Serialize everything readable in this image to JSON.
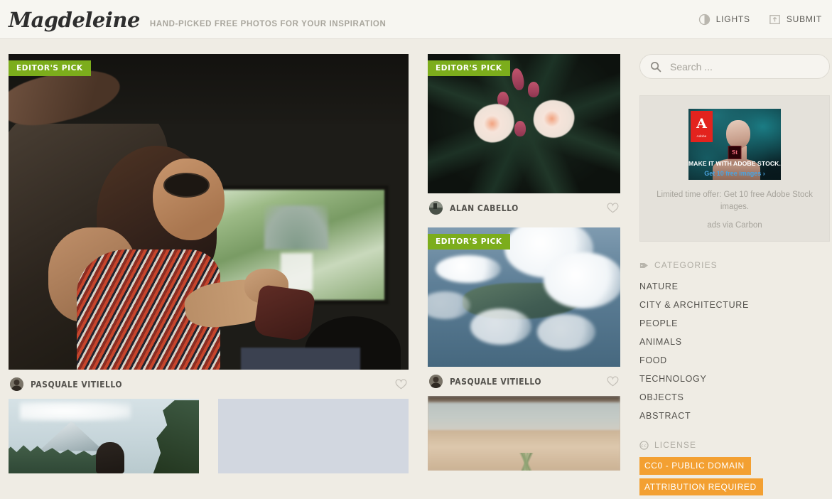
{
  "header": {
    "logo": "Magdeleine",
    "tagline": "HAND-PICKED FREE PHOTOS FOR YOUR INSPIRATION",
    "actions": [
      {
        "label": "LIGHTS",
        "icon": "contrast-icon"
      },
      {
        "label": "SUBMIT",
        "icon": "upload-icon"
      }
    ]
  },
  "badges": {
    "editors_pick": "EDITOR'S PICK"
  },
  "gallery": {
    "left_column": [
      {
        "photo_name": "woman-in-car-window",
        "editors_pick": true,
        "author": "PASQUALE VITIELLO",
        "fav_icon": "heart-outline-icon"
      },
      {
        "photo_name": "mountain-forest-person",
        "editors_pick": false,
        "author": "",
        "fav_icon": "heart-outline-icon"
      },
      {
        "photo_name": "loading-placeholder",
        "editors_pick": false,
        "author": "",
        "fav_icon": "heart-outline-icon"
      }
    ],
    "right_column": [
      {
        "photo_name": "pink-white-oleander-flowers",
        "editors_pick": true,
        "author": "ALAN CABELLO",
        "fav_icon": "heart-outline-icon"
      },
      {
        "photo_name": "clouds-over-coastline",
        "editors_pick": true,
        "author": "PASQUALE VITIELLO",
        "fav_icon": "heart-outline-icon"
      },
      {
        "photo_name": "desert-plant-closeup",
        "editors_pick": false,
        "author": "",
        "fav_icon": "heart-outline-icon"
      }
    ]
  },
  "sidebar": {
    "search": {
      "placeholder": "Search ...",
      "value": "",
      "icon": "search-icon"
    },
    "ad": {
      "logo_letter": "A",
      "logo_sub": "Adobe",
      "product_badge": "St",
      "creative_tagline": "MAKE IT WITH ADOBE STOCK.",
      "creative_cta": "Get 10 free images ›",
      "description": "Limited time offer: Get 10 free Adobe Stock images.",
      "via": "ads via Carbon"
    },
    "categories": {
      "title": "CATEGORIES",
      "icon": "tag-icon",
      "items": [
        "NATURE",
        "CITY & ARCHITECTURE",
        "PEOPLE",
        "ANIMALS",
        "FOOD",
        "TECHNOLOGY",
        "OBJECTS",
        "ABSTRACT"
      ]
    },
    "license": {
      "title": "LICENSE",
      "icon": "cc-icon",
      "tags": [
        "CC0 - PUBLIC DOMAIN",
        "ATTRIBUTION REQUIRED"
      ]
    }
  },
  "colors": {
    "page_bg": "#efece4",
    "header_bg": "#f7f6f1",
    "editors_pick_green": "#7cad1c",
    "license_orange": "#f3a032",
    "text_dark": "#55534e",
    "text_muted": "#a7a49c"
  }
}
